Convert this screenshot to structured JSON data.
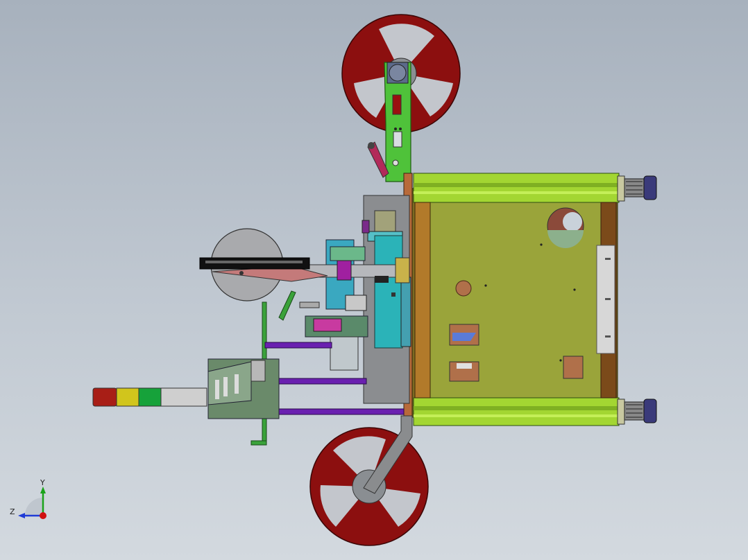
{
  "triad": {
    "y_label": "Y",
    "z_label": "Z",
    "colors": {
      "y": "#1aa31a",
      "z": "#1f3bd6",
      "x": "#d01010"
    }
  },
  "palette": {
    "reel_red": "#8c0f0f",
    "arm_green": "#4fc23a",
    "frame_lime": "#a3d632",
    "plate_olive": "#9aa43a",
    "tower_light": [
      "#a81e16",
      "#d1c51c",
      "#16a23a",
      "#c9c9c9"
    ]
  }
}
